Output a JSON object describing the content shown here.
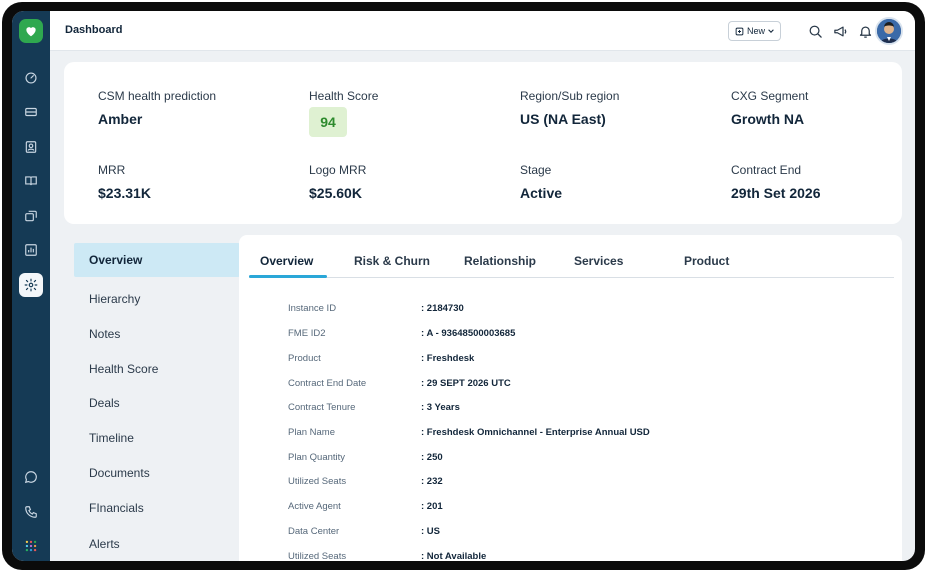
{
  "header": {
    "title": "Dashboard",
    "new_label": "New"
  },
  "summary": [
    {
      "label": "CSM health prediction",
      "value": "Amber"
    },
    {
      "label": "Health Score",
      "value": "94"
    },
    {
      "label": "Region/Sub region",
      "value": "US (NA East)"
    },
    {
      "label": "CXG Segment",
      "value": "Growth NA"
    },
    {
      "label": "MRR",
      "value": "$23.31K"
    },
    {
      "label": "Logo MRR",
      "value": "$25.60K"
    },
    {
      "label": "Stage",
      "value": "Active"
    },
    {
      "label": "Contract End",
      "value": "29th Set 2026"
    }
  ],
  "leftnav": [
    "Overview",
    "Hierarchy",
    "Notes",
    "Health Score",
    "Deals",
    "Timeline",
    "Documents",
    "FInancials",
    "Alerts"
  ],
  "tabs": [
    "Overview",
    "Risk & Churn",
    "Relationship",
    "Services",
    "Product"
  ],
  "details": [
    {
      "key": "Instance ID",
      "value": ": 2184730"
    },
    {
      "key": "FME ID2",
      "value": ": A - 93648500003685"
    },
    {
      "key": "Product",
      "value": ": Freshdesk"
    },
    {
      "key": "Contract End Date",
      "value": ": 29 SEPT 2026 UTC"
    },
    {
      "key": "Contract Tenure",
      "value": ": 3 Years"
    },
    {
      "key": "Plan Name",
      "value": ": Freshdesk Omnichannel - Enterprise Annual USD"
    },
    {
      "key": "Plan Quantity",
      "value": ": 250"
    },
    {
      "key": "Utilized Seats",
      "value": ": 232"
    },
    {
      "key": "Active Agent",
      "value": ": 201"
    },
    {
      "key": "Data Center",
      "value": ": US"
    },
    {
      "key": "Utilized Seats",
      "value": ": Not Available"
    }
  ],
  "colors": {
    "sidebar": "#153a55",
    "brand_green": "#2fa84f",
    "accent_blue": "#2aa7d8",
    "active_nav": "#cde9f5",
    "score_bg": "#dff1d2"
  }
}
